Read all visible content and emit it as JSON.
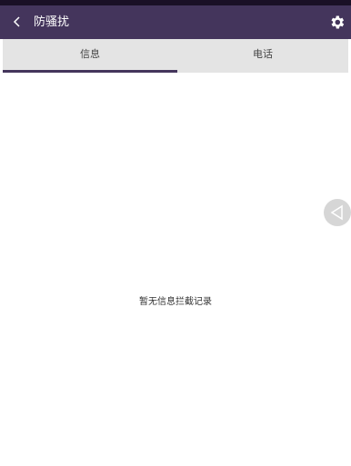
{
  "appbar": {
    "title": "防骚扰"
  },
  "tabs": [
    {
      "label": "信息",
      "selected": true
    },
    {
      "label": "电话",
      "selected": false
    }
  ],
  "content": {
    "empty_message": "暂无信息拦截记录"
  },
  "colors": {
    "accent": "#44355c",
    "tab_bar": "#e4e4e4"
  },
  "icons": {
    "back": "chevron-left-icon",
    "settings": "gear-icon",
    "floating": "triangle-left-icon"
  }
}
